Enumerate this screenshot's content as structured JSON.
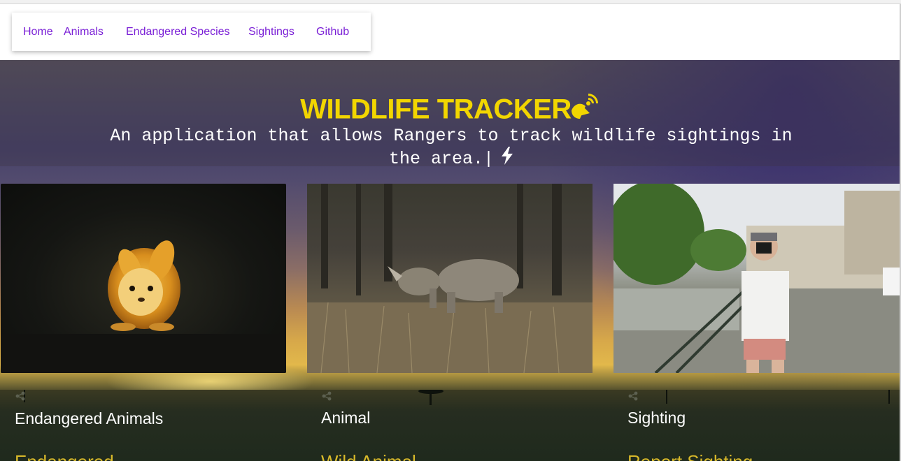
{
  "nav": {
    "items": [
      {
        "label": "Home"
      },
      {
        "label": "Animals"
      },
      {
        "label": "Endangered Species"
      },
      {
        "label": "Sightings"
      },
      {
        "label": "Github"
      }
    ]
  },
  "hero": {
    "title": "WILDLIFE TRACKER",
    "subtitle": "An application that allows Rangers to track wildlife sightings in the area.|",
    "title_color": "#f2d600",
    "icons": {
      "title_icon": "satellite-dish-icon",
      "subtitle_icon": "lightning-bolt-icon"
    }
  },
  "cards": [
    {
      "image": "squirrel-photo",
      "title": "Endangered Animals",
      "link": "Endangered"
    },
    {
      "image": "rhino-photo",
      "title": "Animal",
      "link": "Wild Animal"
    },
    {
      "image": "photographer-photo",
      "title": "Sighting",
      "link": "Report Sighting"
    }
  ],
  "colors": {
    "nav_link": "#7a1fd6",
    "card_link": "#d8b92a"
  }
}
